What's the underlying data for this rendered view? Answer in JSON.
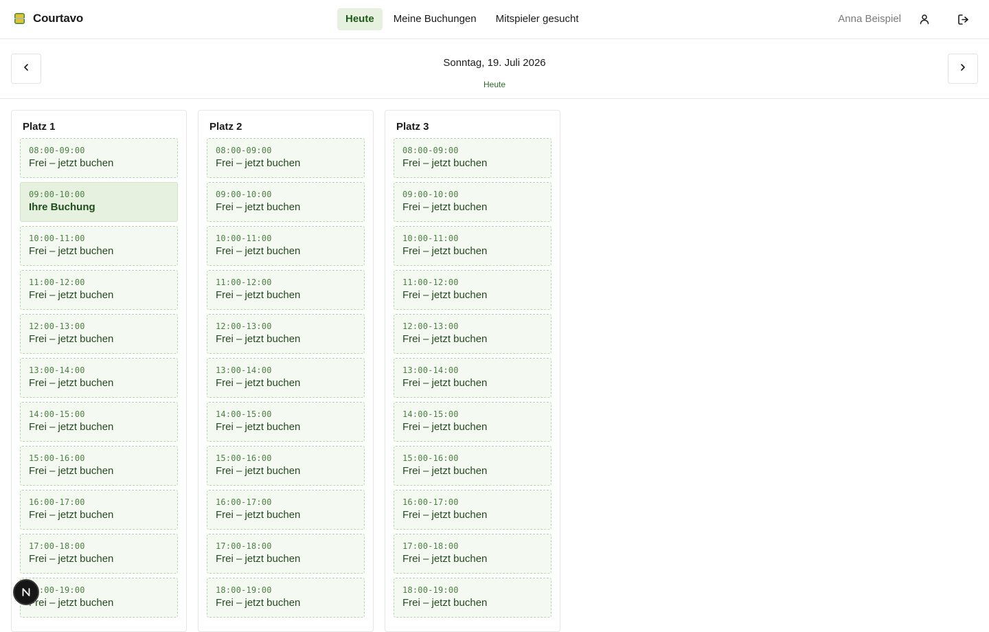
{
  "app": {
    "name": "Courtavo"
  },
  "nav": {
    "items": [
      "Heute",
      "Meine Buchungen",
      "Mitspieler gesucht"
    ],
    "active": 0
  },
  "user": {
    "name": "Anna Beispiel"
  },
  "date": {
    "title": "Sonntag, 19. Juli 2026",
    "subtitle": "Heute"
  },
  "colors": {
    "accent": "#1f5a1a",
    "slot_bg": "#f4faf1",
    "booked_bg": "#e6f2df"
  },
  "courts": [
    {
      "name": "Platz 1",
      "slots": [
        {
          "time": "08:00-09:00",
          "label": "Frei – jetzt buchen",
          "booked": false
        },
        {
          "time": "09:00-10:00",
          "label": "Ihre Buchung",
          "booked": true
        },
        {
          "time": "10:00-11:00",
          "label": "Frei – jetzt buchen",
          "booked": false
        },
        {
          "time": "11:00-12:00",
          "label": "Frei – jetzt buchen",
          "booked": false
        },
        {
          "time": "12:00-13:00",
          "label": "Frei – jetzt buchen",
          "booked": false
        },
        {
          "time": "13:00-14:00",
          "label": "Frei – jetzt buchen",
          "booked": false
        },
        {
          "time": "14:00-15:00",
          "label": "Frei – jetzt buchen",
          "booked": false
        },
        {
          "time": "15:00-16:00",
          "label": "Frei – jetzt buchen",
          "booked": false
        },
        {
          "time": "16:00-17:00",
          "label": "Frei – jetzt buchen",
          "booked": false
        },
        {
          "time": "17:00-18:00",
          "label": "Frei – jetzt buchen",
          "booked": false
        },
        {
          "time": "18:00-19:00",
          "label": "Frei – jetzt buchen",
          "booked": false
        }
      ]
    },
    {
      "name": "Platz 2",
      "slots": [
        {
          "time": "08:00-09:00",
          "label": "Frei – jetzt buchen",
          "booked": false
        },
        {
          "time": "09:00-10:00",
          "label": "Frei – jetzt buchen",
          "booked": false
        },
        {
          "time": "10:00-11:00",
          "label": "Frei – jetzt buchen",
          "booked": false
        },
        {
          "time": "11:00-12:00",
          "label": "Frei – jetzt buchen",
          "booked": false
        },
        {
          "time": "12:00-13:00",
          "label": "Frei – jetzt buchen",
          "booked": false
        },
        {
          "time": "13:00-14:00",
          "label": "Frei – jetzt buchen",
          "booked": false
        },
        {
          "time": "14:00-15:00",
          "label": "Frei – jetzt buchen",
          "booked": false
        },
        {
          "time": "15:00-16:00",
          "label": "Frei – jetzt buchen",
          "booked": false
        },
        {
          "time": "16:00-17:00",
          "label": "Frei – jetzt buchen",
          "booked": false
        },
        {
          "time": "17:00-18:00",
          "label": "Frei – jetzt buchen",
          "booked": false
        },
        {
          "time": "18:00-19:00",
          "label": "Frei – jetzt buchen",
          "booked": false
        }
      ]
    },
    {
      "name": "Platz 3",
      "slots": [
        {
          "time": "08:00-09:00",
          "label": "Frei – jetzt buchen",
          "booked": false
        },
        {
          "time": "09:00-10:00",
          "label": "Frei – jetzt buchen",
          "booked": false
        },
        {
          "time": "10:00-11:00",
          "label": "Frei – jetzt buchen",
          "booked": false
        },
        {
          "time": "11:00-12:00",
          "label": "Frei – jetzt buchen",
          "booked": false
        },
        {
          "time": "12:00-13:00",
          "label": "Frei – jetzt buchen",
          "booked": false
        },
        {
          "time": "13:00-14:00",
          "label": "Frei – jetzt buchen",
          "booked": false
        },
        {
          "time": "14:00-15:00",
          "label": "Frei – jetzt buchen",
          "booked": false
        },
        {
          "time": "15:00-16:00",
          "label": "Frei – jetzt buchen",
          "booked": false
        },
        {
          "time": "16:00-17:00",
          "label": "Frei – jetzt buchen",
          "booked": false
        },
        {
          "time": "17:00-18:00",
          "label": "Frei – jetzt buchen",
          "booked": false
        },
        {
          "time": "18:00-19:00",
          "label": "Frei – jetzt buchen",
          "booked": false
        }
      ]
    }
  ],
  "icons": {
    "logo": "tennis-court-logo-icon",
    "user": "person-icon",
    "logout": "logout-icon",
    "prev": "chevron-left-icon",
    "next": "chevron-right-icon",
    "badge": "n-badge-icon"
  }
}
